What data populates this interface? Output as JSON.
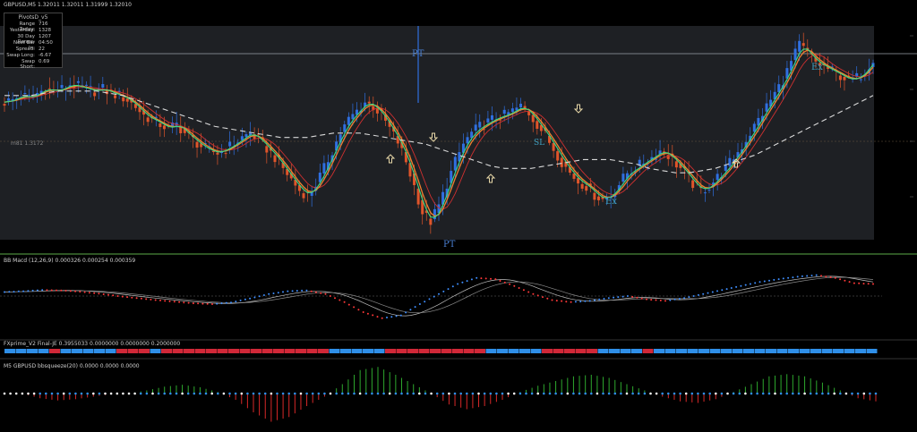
{
  "window": {
    "title": "GBPUSD,M5  1.32011 1.32011 1.31999 1.32010"
  },
  "pivot_box": {
    "header": "PivotsD_v5",
    "rows": [
      {
        "key": "Range  Today:",
        "value": "716"
      },
      {
        "key": "Yesterday:",
        "value": "1328"
      },
      {
        "key": "30 Day Range:",
        "value": "1207"
      },
      {
        "key": "Next Bar In:",
        "value": "04:50"
      },
      {
        "key": "Spread:",
        "value": "22"
      },
      {
        "key": "Swap  Long:",
        "value": "-6.67"
      },
      {
        "key": "Swap  Short:",
        "value": "0.69"
      }
    ]
  },
  "level_label": "m81  1.3172",
  "annotations": {
    "pt_top": "PT",
    "pt_bottom": "PT",
    "ex_low": "Ex",
    "ex_high": "Ex",
    "sl_mid": "SL"
  },
  "colors": {
    "background": "#000000",
    "panel": "#1e2024",
    "bull": "#2f6fe0",
    "bear": "#e0552a",
    "ma_fast": "#3ddc84",
    "ma_mid": "#f08030",
    "ma_slow": "#d03030",
    "dash": "#d8d8d8",
    "blue_bar": "#2f8fe8",
    "red_bar": "#d02838",
    "green_hist": "#2ea82e",
    "red_hist": "#d82828"
  },
  "panels": {
    "macd_title": "BB Macd (12,26,9) 0.000326 0.000254 0.000359",
    "fx_title": "FXprime_V2 Final-JE 0.3955033 0.0000000 0.0000000 0.2000000",
    "sq_title": "M5 GBPUSD bbsqueeze(20) 0.0000 0.0000 0.0000"
  },
  "chart_data": [
    {
      "type": "candlestick",
      "title": "GBPUSD,M5  1.32011 1.32011 1.31999 1.32010",
      "series": [
        {
          "name": "price",
          "values": [
            0.52,
            0.53,
            0.55,
            0.54,
            0.56,
            0.58,
            0.57,
            0.58,
            0.6,
            0.59,
            0.58,
            0.57,
            0.58,
            0.56,
            0.55,
            0.53,
            0.5,
            0.46,
            0.44,
            0.42,
            0.4,
            0.42,
            0.38,
            0.35,
            0.32,
            0.3,
            0.29,
            0.31,
            0.33,
            0.36,
            0.38,
            0.35,
            0.31,
            0.27,
            0.22,
            0.17,
            0.12,
            0.1,
            0.15,
            0.22,
            0.3,
            0.38,
            0.44,
            0.48,
            0.52,
            0.5,
            0.46,
            0.4,
            0.34,
            0.25,
            0.14,
            0.02,
            -0.02,
            0.05,
            0.15,
            0.25,
            0.33,
            0.38,
            0.41,
            0.43,
            0.45,
            0.46,
            0.48,
            0.5,
            0.47,
            0.42,
            0.37,
            0.31,
            0.25,
            0.2,
            0.16,
            0.14,
            0.1,
            0.08,
            0.1,
            0.15,
            0.2,
            0.22,
            0.25,
            0.27,
            0.3,
            0.28,
            0.24,
            0.2,
            0.15,
            0.12,
            0.14,
            0.18,
            0.22,
            0.27,
            0.32,
            0.38,
            0.44,
            0.5,
            0.56,
            0.62,
            0.7,
            0.78,
            0.74,
            0.7,
            0.68,
            0.66,
            0.64,
            0.62,
            0.63,
            0.66,
            0.72
          ]
        },
        {
          "name": "ma_fast",
          "values": [
            0.52,
            0.53,
            0.55,
            0.54,
            0.56,
            0.58,
            0.57,
            0.58,
            0.6,
            0.59,
            0.58,
            0.57,
            0.58,
            0.56,
            0.55,
            0.53,
            0.5,
            0.46,
            0.44,
            0.42,
            0.4,
            0.42,
            0.38,
            0.35,
            0.32,
            0.3,
            0.29,
            0.31,
            0.33,
            0.36,
            0.38,
            0.35,
            0.31,
            0.27,
            0.22,
            0.17,
            0.12,
            0.1,
            0.15,
            0.22,
            0.3,
            0.38,
            0.44,
            0.48,
            0.52,
            0.5,
            0.46,
            0.4,
            0.34,
            0.25,
            0.14,
            0.02,
            -0.02,
            0.05,
            0.15,
            0.25,
            0.33,
            0.38,
            0.41,
            0.43,
            0.45,
            0.46,
            0.48,
            0.5,
            0.47,
            0.42,
            0.37,
            0.31,
            0.25,
            0.2,
            0.16,
            0.14,
            0.1,
            0.08,
            0.1,
            0.15,
            0.2,
            0.22,
            0.25,
            0.27,
            0.3,
            0.28,
            0.24,
            0.2,
            0.15,
            0.12,
            0.14,
            0.18,
            0.22,
            0.27,
            0.32,
            0.38,
            0.44,
            0.5,
            0.56,
            0.62,
            0.7,
            0.78,
            0.74,
            0.7,
            0.68,
            0.66,
            0.64,
            0.62,
            0.63,
            0.66,
            0.72
          ]
        },
        {
          "name": "ma_slow",
          "values": [
            0.55,
            0.55,
            0.55,
            0.56,
            0.57,
            0.57,
            0.57,
            0.57,
            0.56,
            0.55,
            0.53,
            0.51,
            0.49,
            0.47,
            0.45,
            0.43,
            0.41,
            0.4,
            0.39,
            0.38,
            0.37,
            0.36,
            0.36,
            0.36,
            0.37,
            0.38,
            0.38,
            0.38,
            0.37,
            0.36,
            0.35,
            0.34,
            0.33,
            0.31,
            0.29,
            0.27,
            0.25,
            0.23,
            0.22,
            0.22,
            0.22,
            0.23,
            0.24,
            0.25,
            0.26,
            0.26,
            0.26,
            0.25,
            0.24,
            0.22,
            0.21,
            0.2,
            0.2,
            0.21,
            0.22,
            0.24,
            0.26,
            0.28,
            0.31,
            0.34,
            0.37,
            0.4,
            0.43,
            0.46,
            0.49,
            0.52,
            0.55
          ]
        }
      ]
    },
    {
      "type": "line",
      "title": "BB Macd (12,26,9) 0.000326 0.000254 0.000359",
      "series": [
        {
          "name": "macd",
          "values": [
            0.1,
            0.12,
            0.15,
            0.14,
            0.11,
            0.06,
            0.0,
            -0.05,
            -0.1,
            -0.14,
            -0.18,
            -0.2,
            -0.16,
            -0.06,
            0.05,
            0.12,
            0.14,
            0.05,
            -0.15,
            -0.4,
            -0.55,
            -0.48,
            -0.2,
            0.05,
            0.3,
            0.45,
            0.42,
            0.25,
            0.05,
            -0.1,
            -0.15,
            -0.12,
            -0.05,
            0.0,
            -0.08,
            -0.12,
            -0.05,
            0.05,
            0.15,
            0.25,
            0.35,
            0.42,
            0.48,
            0.52,
            0.45,
            0.32,
            0.3
          ]
        }
      ]
    },
    {
      "type": "bar",
      "title": "FXprime_V2 Final-JE 0.3955033 0.0000000 0.0000000 0.2000000",
      "values": [
        1,
        1,
        1,
        1,
        -1,
        1,
        1,
        1,
        1,
        1,
        -1,
        -1,
        -1,
        1,
        -1,
        -1,
        -1,
        -1,
        -1,
        -1,
        -1,
        -1,
        -1,
        -1,
        -1,
        -1,
        -1,
        -1,
        -1,
        1,
        1,
        1,
        1,
        1,
        -1,
        -1,
        -1,
        -1,
        -1,
        -1,
        -1,
        -1,
        -1,
        1,
        1,
        1,
        1,
        1,
        -1,
        -1,
        -1,
        -1,
        -1,
        1,
        1,
        1,
        1,
        -1,
        1,
        1,
        1,
        1,
        1,
        1,
        1,
        1,
        1,
        1,
        1,
        1,
        1,
        1,
        1,
        1,
        1,
        1,
        1,
        1
      ]
    },
    {
      "type": "bar",
      "title": "M5 GBPUSD bbsqueeze(20) 0.0000 0.0000 0.0000",
      "values": [
        0.0,
        0.0,
        -0.15,
        -0.22,
        -0.18,
        -0.1,
        -0.02,
        0.0,
        0.1,
        0.22,
        0.28,
        0.2,
        0.05,
        -0.2,
        -0.6,
        -0.9,
        -0.75,
        -0.4,
        -0.1,
        0.3,
        0.75,
        0.85,
        0.6,
        0.3,
        0.0,
        -0.35,
        -0.5,
        -0.4,
        -0.2,
        0.05,
        0.25,
        0.4,
        0.55,
        0.6,
        0.5,
        0.3,
        0.1,
        -0.1,
        -0.25,
        -0.3,
        -0.18,
        0.05,
        0.3,
        0.55,
        0.62,
        0.55,
        0.35,
        0.1,
        -0.15,
        -0.25
      ]
    }
  ]
}
